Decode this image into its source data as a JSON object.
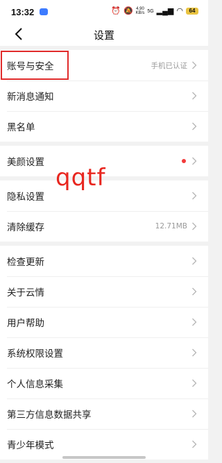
{
  "status_bar": {
    "time": "13:32",
    "net_speed_value": "4.90",
    "net_speed_unit": "KB/s",
    "network": "5G",
    "battery": "64"
  },
  "header": {
    "title": "设置"
  },
  "groups": [
    [
      {
        "label": "账号与安全",
        "value": "手机已认证"
      },
      {
        "label": "新消息通知"
      },
      {
        "label": "黑名单"
      }
    ],
    [
      {
        "label": "美颜设置",
        "has_dot": true
      }
    ],
    [
      {
        "label": "隐私设置"
      },
      {
        "label": "清除缓存",
        "value": "12.71MB"
      }
    ],
    [
      {
        "label": "检查更新"
      },
      {
        "label": "关于云情"
      },
      {
        "label": "用户帮助"
      },
      {
        "label": "系统权限设置"
      },
      {
        "label": "个人信息采集"
      },
      {
        "label": "第三方信息数据共享"
      },
      {
        "label": "青少年模式"
      }
    ]
  ],
  "watermark": "qqtf",
  "colors": {
    "dot": "#f23a3a",
    "highlight_box": "#e02b2b",
    "watermark": "#e8261f"
  }
}
